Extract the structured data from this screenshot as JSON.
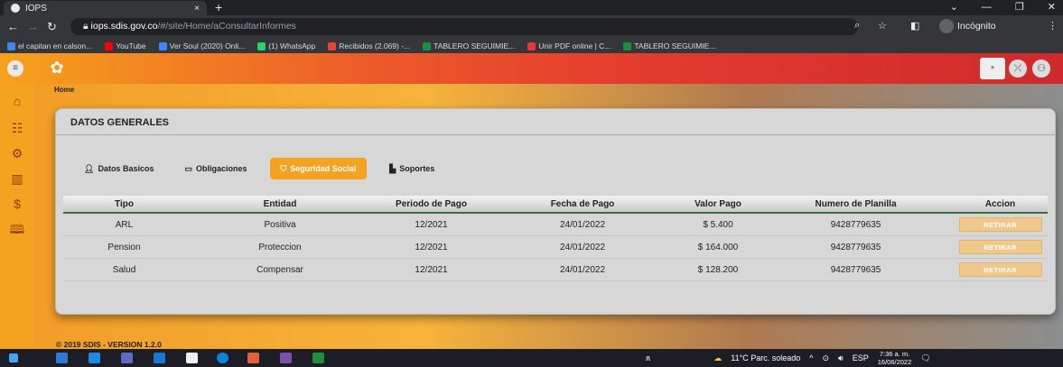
{
  "browser": {
    "tab_title": "IOPS",
    "tab_close": "×",
    "new_tab": "+",
    "url_host": "iops.sdis.gov.co",
    "url_path": "/#/site/Home/aConsultarInformes",
    "incognito_label": "Incógnito",
    "bookmarks": [
      {
        "label": "el capitan en calson...",
        "color": "#4285f4"
      },
      {
        "label": "YouTube",
        "color": "#ff0000"
      },
      {
        "label": "Ver Soul (2020) Onli...",
        "color": "#4285f4"
      },
      {
        "label": "(1) WhatsApp",
        "color": "#25d366"
      },
      {
        "label": "Recibidos (2.069) -...",
        "color": "#ea4335"
      },
      {
        "label": "TABLERO SEGUIMIE...",
        "color": "#1e8e3e"
      },
      {
        "label": "Unir PDF online | C...",
        "color": "#e53935"
      },
      {
        "label": "TABLERO SEGUIMIE...",
        "color": "#1e8e3e"
      }
    ]
  },
  "app": {
    "breadcrumb": "Home",
    "card_title": "DATOS GENERALES",
    "tabs": [
      {
        "label": "Datos Basicos",
        "icon": "users-icon"
      },
      {
        "label": "Obligaciones",
        "icon": "id-card-icon"
      },
      {
        "label": "Seguridad Social",
        "icon": "shield-icon",
        "active": true
      },
      {
        "label": "Soportes",
        "icon": "folder-icon"
      }
    ],
    "table": {
      "headers": [
        "Tipo",
        "Entidad",
        "Periodo de Pago",
        "Fecha de Pago",
        "Valor Pago",
        "Numero de Planilla",
        "Accion"
      ],
      "rows": [
        {
          "tipo": "ARL",
          "entidad": "Positiva",
          "periodo": "12/2021",
          "fecha": "24/01/2022",
          "valor": "$ 5.400",
          "planilla": "9428779635",
          "accion": "RETIRAR"
        },
        {
          "tipo": "Pension",
          "entidad": "Proteccion",
          "periodo": "12/2021",
          "fecha": "24/01/2022",
          "valor": "$ 164.000",
          "planilla": "9428779635",
          "accion": "RETIRAR"
        },
        {
          "tipo": "Salud",
          "entidad": "Compensar",
          "periodo": "12/2021",
          "fecha": "24/01/2022",
          "valor": "$ 128.200",
          "planilla": "9428779635",
          "accion": "RETIRAR"
        }
      ]
    },
    "footer": "© 2019 SDIS - VERSION 1.2.0",
    "accent_color": "#f4a320"
  },
  "taskbar": {
    "weather": "11°C  Parc. soleado",
    "lang": "ESP",
    "time": "7:36 a. m.",
    "date": "16/06/2022"
  }
}
